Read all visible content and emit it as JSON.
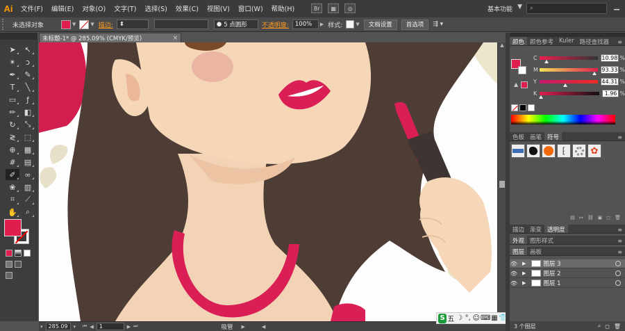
{
  "app": {
    "logo": "Ai",
    "workspace": "基本功能",
    "search_placeholder": ""
  },
  "menu": [
    "文件(F)",
    "编辑(E)",
    "对象(O)",
    "文字(T)",
    "选择(S)",
    "效果(C)",
    "视图(V)",
    "窗口(W)",
    "帮助(H)"
  ],
  "control_bar": {
    "selection_status": "未选择对象",
    "stroke_label": "描边:",
    "brush_label": "5 点圆形",
    "opacity_label": "不透明度:",
    "opacity_value": "100%",
    "style_label": "样式:",
    "doc_setup_button": "文档设置",
    "preferences_button": "首选项"
  },
  "document": {
    "tab_title": "未标题-1* @ 285.09% (CMYK/预览)",
    "close": "×"
  },
  "status_bar": {
    "zoom": "285.09",
    "artboard": "1",
    "tool_name": "吸管"
  },
  "ime_bar": {
    "logo": "S",
    "mode": "五",
    "items": [
      "☽",
      "°,",
      "☺",
      "⌨",
      "▦",
      "👕",
      "🔧"
    ]
  },
  "colors": {
    "fill": "#e01e4e",
    "stroke": "#ffffff",
    "accent_orange": "#ff9a1e"
  },
  "color_panel": {
    "tabs": [
      "颜色",
      "颜色参考",
      "Kuler",
      "路径查找器"
    ],
    "channels": [
      {
        "label": "C",
        "value": "10.98",
        "level": 0.11
      },
      {
        "label": "M",
        "value": "93.33",
        "level": 0.93
      },
      {
        "label": "Y",
        "value": "44.31",
        "level": 0.44
      },
      {
        "label": "K",
        "value": "1.96",
        "level": 0.02
      }
    ],
    "pct": "%"
  },
  "swatches_panel": {
    "tabs": [
      "色板",
      "画笔",
      "符号"
    ]
  },
  "stroke_panel": {
    "tabs": [
      "描边",
      "渐变",
      "透明度"
    ]
  },
  "appearance_panel": {
    "tabs": [
      "外观",
      "图形样式"
    ]
  },
  "layers_panel": {
    "tabs": [
      "图层",
      "画板"
    ],
    "layers": [
      {
        "name": "图层 3",
        "selected": true
      },
      {
        "name": "图层 2",
        "selected": false
      },
      {
        "name": "图层 1",
        "selected": false
      }
    ],
    "footer": "3 个图层"
  }
}
